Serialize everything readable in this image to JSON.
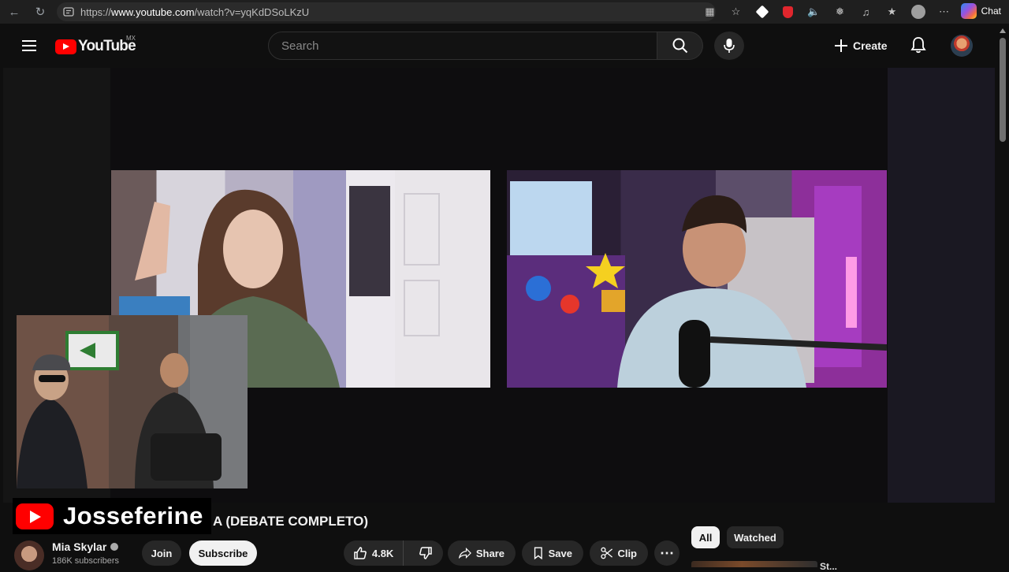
{
  "browser": {
    "url_prefix": "https://",
    "url_host": "www.youtube.com",
    "url_path": "/watch?v=yqKdDSoLKzU",
    "chat_label": "Chat"
  },
  "header": {
    "logo_text": "YouTube",
    "country_code": "MX",
    "search_placeholder": "Search",
    "create_label": "Create"
  },
  "overlay": {
    "brand_name": "Josseferine"
  },
  "video": {
    "title_visible": "A (DEBATE COMPLETO)"
  },
  "channel": {
    "name": "Mia Skylar",
    "subscribers": "186K subscribers",
    "join_label": "Join",
    "subscribe_label": "Subscribe"
  },
  "actions": {
    "likes": "4.8K",
    "share_label": "Share",
    "save_label": "Save",
    "clip_label": "Clip"
  },
  "chips": {
    "all": "All",
    "watched": "Watched"
  },
  "recommendation": {
    "title_fragment": "St..."
  },
  "colors": {
    "brand_red": "#ff0000",
    "background": "#0f0f0f",
    "surface": "#272727"
  }
}
